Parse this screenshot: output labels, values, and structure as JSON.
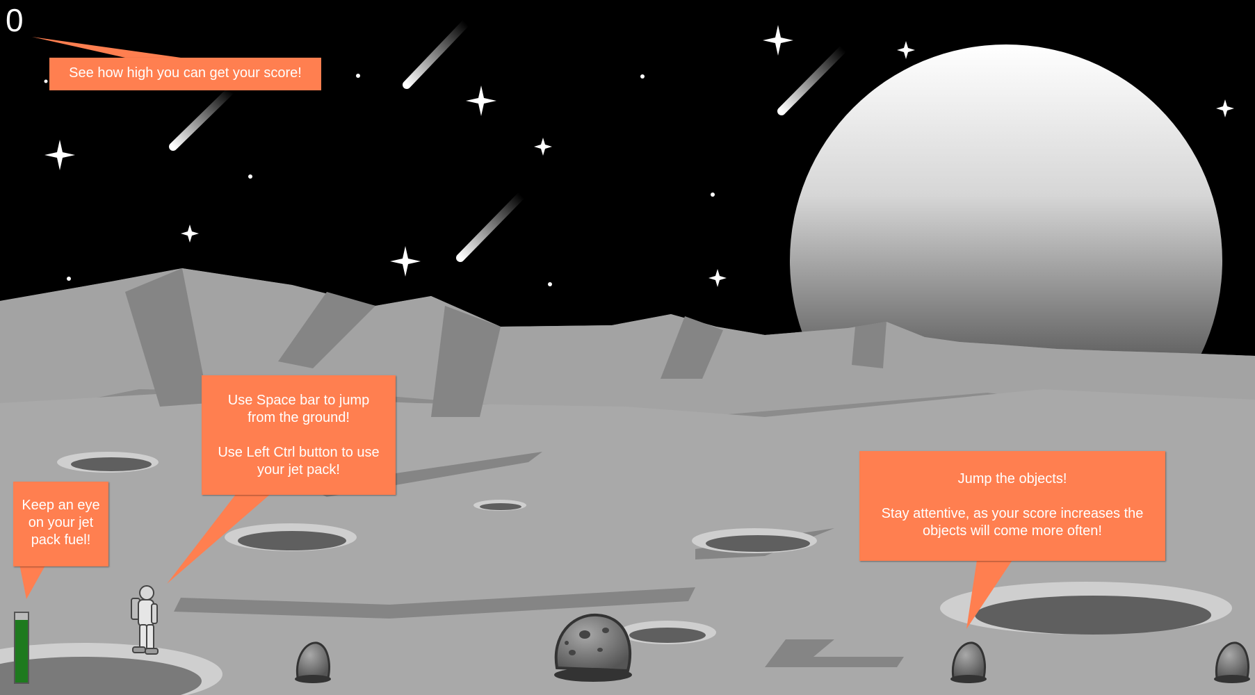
{
  "hud": {
    "score": "0",
    "fuel_level": 0.9,
    "fuel_color": "#1e7a1e"
  },
  "tips": {
    "score": {
      "text": "See how high you can get your score!"
    },
    "controls": {
      "line1": "Use Space bar to jump",
      "line2": "from the ground!",
      "line3": "Use Left Ctrl button to use",
      "line4": "your jet pack!"
    },
    "fuel": {
      "line1": "Keep an eye",
      "line2": "on your jet",
      "line3": "pack fuel!"
    },
    "objects": {
      "line1": "Jump the objects!",
      "line2": "Stay attentive, as your score increases the",
      "line3": "objects will come more often!"
    }
  },
  "colors": {
    "tip_background": "#ff7f50",
    "sky": "#000000",
    "ground": "#a6a6a6"
  },
  "icons": {
    "player": "astronaut-icon",
    "obstacle": "rock-icon",
    "big_obstacle": "meteor-icon",
    "planet": "planet-icon"
  }
}
